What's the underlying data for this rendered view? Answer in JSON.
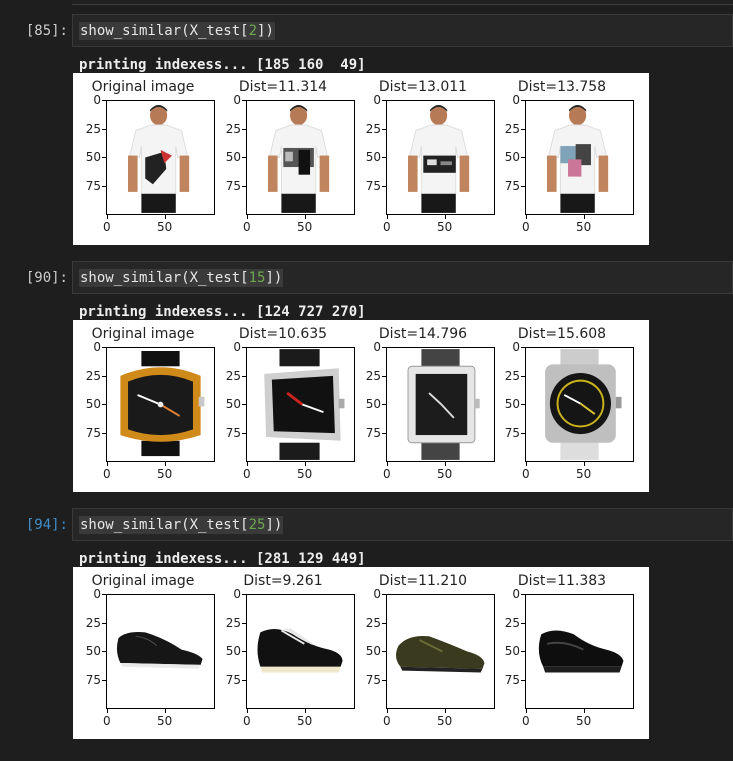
{
  "cells": [
    {
      "prompt": "[85]:",
      "code_prefix": "show_similar(X_test[",
      "code_num": "2",
      "code_suffix": "])",
      "output": "printing indexess... [185 160  49]",
      "subplots": [
        {
          "title": "Original image",
          "item": "tshirt-1"
        },
        {
          "title": "Dist=11.314",
          "item": "tshirt-2"
        },
        {
          "title": "Dist=13.011",
          "item": "tshirt-3"
        },
        {
          "title": "Dist=13.758",
          "item": "tshirt-4"
        }
      ]
    },
    {
      "prompt": "[90]:",
      "code_prefix": "show_similar(X_test[",
      "code_num": "15",
      "code_suffix": "])",
      "output": "printing indexess... [124 727 270]",
      "subplots": [
        {
          "title": "Original image",
          "item": "watch-1"
        },
        {
          "title": "Dist=10.635",
          "item": "watch-2"
        },
        {
          "title": "Dist=14.796",
          "item": "watch-3"
        },
        {
          "title": "Dist=15.608",
          "item": "watch-4"
        }
      ]
    },
    {
      "prompt": "[94]:",
      "code_prefix": "show_similar(X_test[",
      "code_num": "25",
      "code_suffix": "])",
      "output": "printing indexess... [281 129 449]",
      "subplots": [
        {
          "title": "Original image",
          "item": "shoe-1"
        },
        {
          "title": "Dist=9.261",
          "item": "shoe-2"
        },
        {
          "title": "Dist=11.210",
          "item": "shoe-3"
        },
        {
          "title": "Dist=11.383",
          "item": "shoe-4"
        }
      ]
    }
  ],
  "axis": {
    "yticks": [
      "0",
      "25",
      "50",
      "75"
    ],
    "xticks": [
      "0",
      "50"
    ]
  }
}
